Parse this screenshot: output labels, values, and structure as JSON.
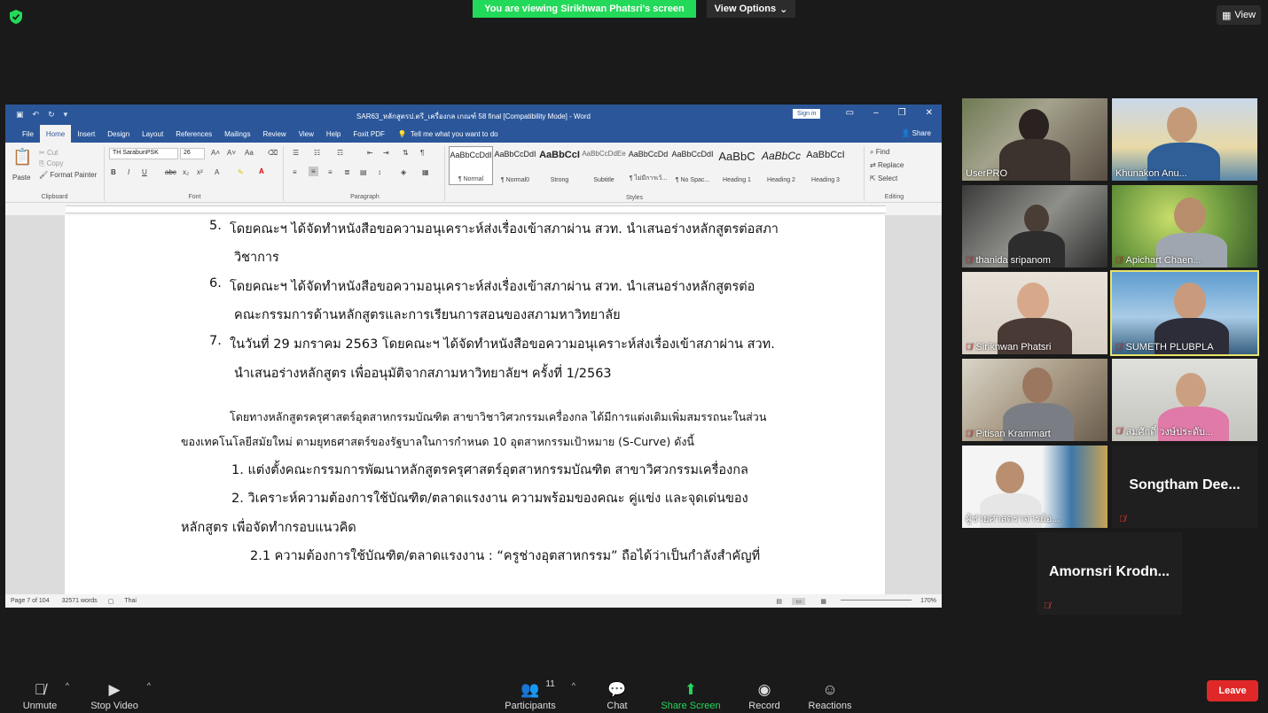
{
  "meeting": {
    "banner": "You are viewing Sirikhwan Phatsri's screen",
    "view_options": "View Options",
    "view_label": "View"
  },
  "word": {
    "title": "SAR63_หลักสูตรป.ตรี_เครื่องกล เกณฑ์ 58 final [Compatibility Mode] - Word",
    "signin": "Sign in",
    "tabs": [
      "File",
      "Home",
      "Insert",
      "Design",
      "Layout",
      "References",
      "Mailings",
      "Review",
      "View",
      "Help",
      "Foxit PDF"
    ],
    "tell_me": "Tell me what you want to do",
    "share": "Share",
    "clipboard": {
      "paste": "Paste",
      "cut": "Cut",
      "copy": "Copy",
      "format_painter": "Format Painter",
      "label": "Clipboard"
    },
    "font": {
      "name": "TH SarabunPSK",
      "size": "26",
      "label": "Font"
    },
    "paragraph_label": "Paragraph",
    "styles_label": "Styles",
    "editing": {
      "find": "Find",
      "replace": "Replace",
      "select": "Select",
      "label": "Editing"
    },
    "styles": [
      {
        "sample": "AaBbCcDdI",
        "name": "¶ Normal"
      },
      {
        "sample": "AaBbCcDdI",
        "name": "¶ Normal0"
      },
      {
        "sample": "AaBbCcI",
        "name": "Strong"
      },
      {
        "sample": "AaBbCcDdEe",
        "name": "Subtitle"
      },
      {
        "sample": "AaBbCcDd",
        "name": "¶ ไม่มีการเว้..."
      },
      {
        "sample": "AaBbCcDdI",
        "name": "¶ No Spac..."
      },
      {
        "sample": "AaBbC",
        "name": "Heading 1"
      },
      {
        "sample": "AaBbCc",
        "name": "Heading 2"
      },
      {
        "sample": "AaBbCcI",
        "name": "Heading 3"
      }
    ],
    "status": {
      "page": "Page 7 of 104",
      "words": "32571 words",
      "lang": "Thai",
      "zoom": "170%"
    },
    "document": {
      "item5_num": "5.",
      "item5_a": "โดยคณะฯ ได้จัดทำหนังสือขอความอนุเคราะห์ส่งเรื่องเข้าสภาผ่าน สวท. นำเสนอร่างหลักสูตรต่อสภา",
      "item5_b": "วิชาการ",
      "item6_num": "6.",
      "item6_a": "โดยคณะฯ ได้จัดทำหนังสือขอความอนุเคราะห์ส่งเรื่องเข้าสภาผ่าน สวท. นำเสนอร่างหลักสูตรต่อ",
      "item6_b": "คณะกรรมการด้านหลักสูตรและการเรียนการสอนของสภามหาวิทยาลัย",
      "item7_num": "7.",
      "item7_a": "ในวันที่ 29 มกราคม 2563 โดยคณะฯ ได้จัดทำหนังสือขอความอนุเคราะห์ส่งเรื่องเข้าสภาผ่าน สวท.",
      "item7_b": "นำเสนอร่างหลักสูตร เพื่ออนุมัติจากสภามหาวิทยาลัยฯ  ครั้งที่ 1/2563",
      "para_a": "โดยทางหลักสูตรครุศาสตร์อุตสาหกรรมบัณฑิต สาขาวิชาวิศวกรรมเครื่องกล ได้มีการแต่งเติมเพิ่มสมรรถนะในส่วน",
      "para_b": "ของเทคโนโลยีสมัยใหม่ ตามยุทธศาสตร์ของรัฐบาลในการกำหนด 10 อุตสาหกรรมเป้าหมาย (S-Curve) ดังนี้",
      "step1": "1. แต่งตั้งคณะกรรมการพัฒนาหลักสูตรครุศาสตร์อุตสาหกรรมบัณฑิต สาขาวิศวกรรมเครื่องกล",
      "step2_a": "2. วิเคราะห์ความต้องการใช้บัณฑิต/ตลาดแรงงาน ความพร้อมของคณะ คู่แข่ง และจุดเด่นของ",
      "step2_b": "หลักสูตร เพื่อจัดทำกรอบแนวคิด",
      "step21": "2.1 ความต้องการใช้บัณฑิต/ตลาดแรงงาน : “ครูช่างอุตสาหกรรม” ถือได้ว่าเป็นกำลังสำคัญที่"
    }
  },
  "participants": [
    {
      "name": "UserPRO",
      "muted": false
    },
    {
      "name": "Khunakon Anu...",
      "muted": false
    },
    {
      "name": "thanida sripanom",
      "muted": true
    },
    {
      "name": "Apichart Chaen...",
      "muted": true
    },
    {
      "name": "Sirikhwan Phatsri",
      "muted": true
    },
    {
      "name": "SUMETH PLUBPLA",
      "muted": true
    },
    {
      "name": "Pitisan Krammart",
      "muted": true
    },
    {
      "name": "สมศักดิ์ วงษ์ประดับ...",
      "muted": true
    },
    {
      "name": "ผู้ช่วยศาสตราจารย์อ...",
      "muted": false
    },
    {
      "name": "Songtham Dee...",
      "muted": true
    },
    {
      "name": "Amornsri Krodn...",
      "muted": true
    }
  ],
  "toolbar": {
    "unmute": "Unmute",
    "stop_video": "Stop Video",
    "participants": "Participants",
    "participants_count": "11",
    "chat": "Chat",
    "share_screen": "Share Screen",
    "record": "Record",
    "reactions": "Reactions",
    "leave": "Leave"
  },
  "colors": {
    "share_green": "#23d959",
    "word_blue": "#2b579a",
    "leave_red": "#e02828",
    "active_speaker": "#e8e26c"
  }
}
